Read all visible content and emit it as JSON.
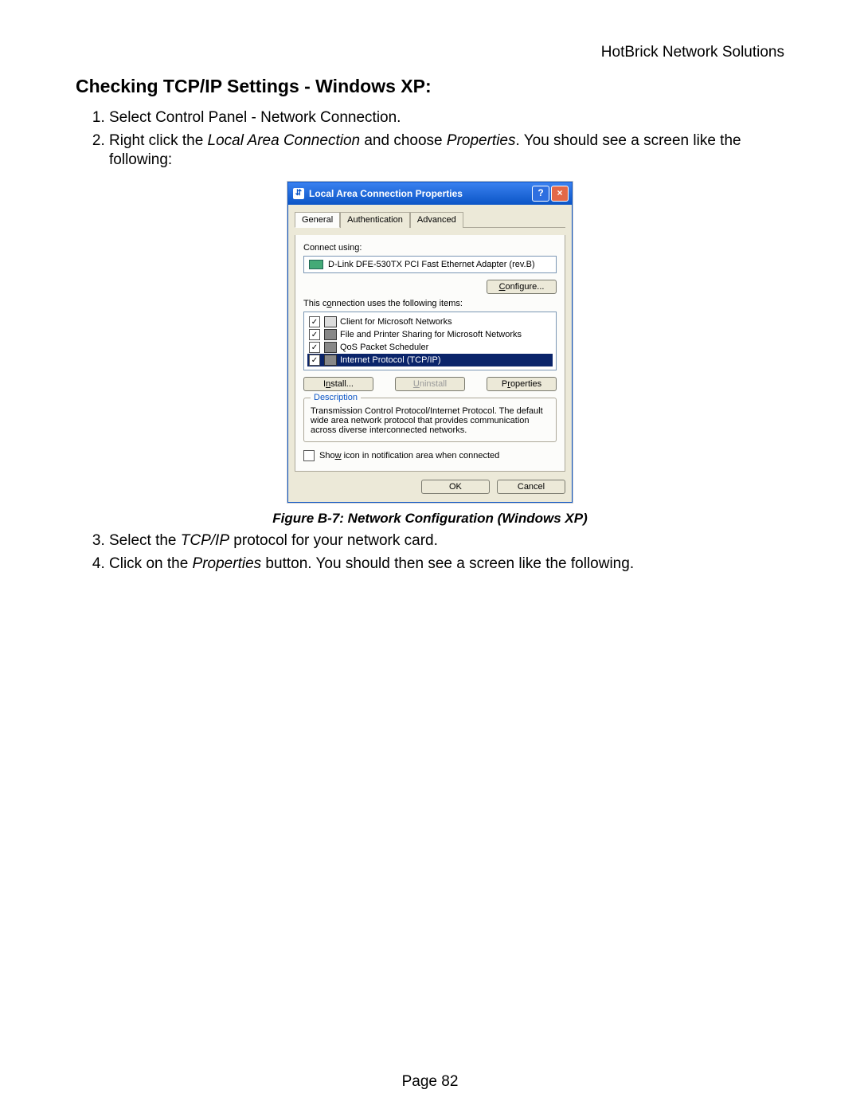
{
  "header": {
    "company": "HotBrick Network Solutions"
  },
  "title": "Checking TCP/IP Settings - Windows XP:",
  "steps_top": [
    {
      "pre": "Select Control Panel - Network Connection."
    },
    {
      "pre": "Right click the ",
      "i1": "Local Area Connection",
      "mid": " and choose ",
      "i2": "Properties",
      "post": ". You should see a screen like the following:"
    }
  ],
  "dialog": {
    "title": "Local Area Connection Properties",
    "tabs": {
      "t0": "General",
      "t1": "Authentication",
      "t2": "Advanced"
    },
    "connect_using_label": "Connect using:",
    "adapter": "D-Link DFE-530TX PCI Fast Ethernet Adapter (rev.B)",
    "configure_u": "C",
    "configure_rest": "onfigure...",
    "items_label_pre": "This c",
    "items_label_u": "o",
    "items_label_post": "nnection uses the following items:",
    "items": {
      "i0": "Client for Microsoft Networks",
      "i1": "File and Printer Sharing for Microsoft Networks",
      "i2": "QoS Packet Scheduler",
      "i3": "Internet Protocol (TCP/IP)"
    },
    "install_u": "n",
    "install_pre": "I",
    "install_post": "stall...",
    "uninstall_u": "U",
    "uninstall_post": "ninstall",
    "properties_u": "r",
    "properties_pre": "P",
    "properties_post": "operties",
    "desc_title": "Description",
    "desc_text": "Transmission Control Protocol/Internet Protocol. The default wide area network protocol that provides communication across diverse interconnected networks.",
    "show_icon_pre": "Sho",
    "show_icon_u": "w",
    "show_icon_post": " icon in notification area when connected",
    "ok": "OK",
    "cancel": "Cancel"
  },
  "caption": "Figure B-7: Network Configuration (Windows XP)",
  "steps_bottom": [
    {
      "pre": "Select the ",
      "i1": "TCP/IP",
      "post": " protocol for your network card."
    },
    {
      "pre": "Click on the ",
      "i1": "Properties",
      "post": " button. You should then see a screen like the following."
    }
  ],
  "page_num": "Page 82"
}
